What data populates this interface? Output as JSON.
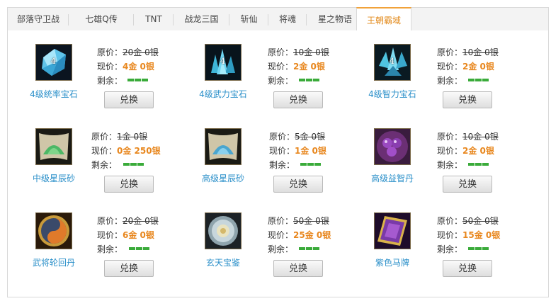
{
  "tabs": [
    "部落守卫战",
    "七雄Q传",
    "TNT",
    "战龙三国",
    "斩仙",
    "将魂",
    "星之物语",
    "王朝霸域"
  ],
  "active_tab": 7,
  "labels": {
    "original": "原价：",
    "current": "现价：",
    "remaining": "剩余：",
    "exchange": "兑换"
  },
  "colors": {
    "accent": "#e8871e",
    "link": "#2a8fc9",
    "stock_bar": "#3aab3a"
  },
  "items": [
    {
      "name": "4级统率宝石",
      "icon": "blue-crystal-gem-icon",
      "level": "4",
      "original": "20金 0银",
      "current": "4金 0银"
    },
    {
      "name": "4级武力宝石",
      "icon": "teal-crystal-cluster-icon",
      "level": "4",
      "original": "10金 0银",
      "current": "2金 0银"
    },
    {
      "name": "4级智力宝石",
      "icon": "cyan-crystal-cluster-icon",
      "level": "4",
      "original": "10金 0银",
      "current": "2金 0银"
    },
    {
      "name": "中级星辰砂",
      "icon": "green-star-sand-icon",
      "level": "",
      "original": "1金 0银",
      "current": "0金 250银"
    },
    {
      "name": "高级星辰砂",
      "icon": "blue-star-sand-icon",
      "level": "",
      "original": "5金 0银",
      "current": "1金 0银"
    },
    {
      "name": "高级益智丹",
      "icon": "purple-pills-icon",
      "level": "",
      "original": "10金 0银",
      "current": "2金 0银"
    },
    {
      "name": "武将轮回丹",
      "icon": "yin-yang-orb-icon",
      "level": "",
      "original": "20金 0银",
      "current": "6金 0银"
    },
    {
      "name": "玄天宝鉴",
      "icon": "silver-mirror-icon",
      "level": "",
      "original": "50金 0银",
      "current": "25金 0银"
    },
    {
      "name": "紫色马牌",
      "icon": "purple-card-icon",
      "level": "",
      "original": "50金 0银",
      "current": "15金 0银"
    }
  ]
}
